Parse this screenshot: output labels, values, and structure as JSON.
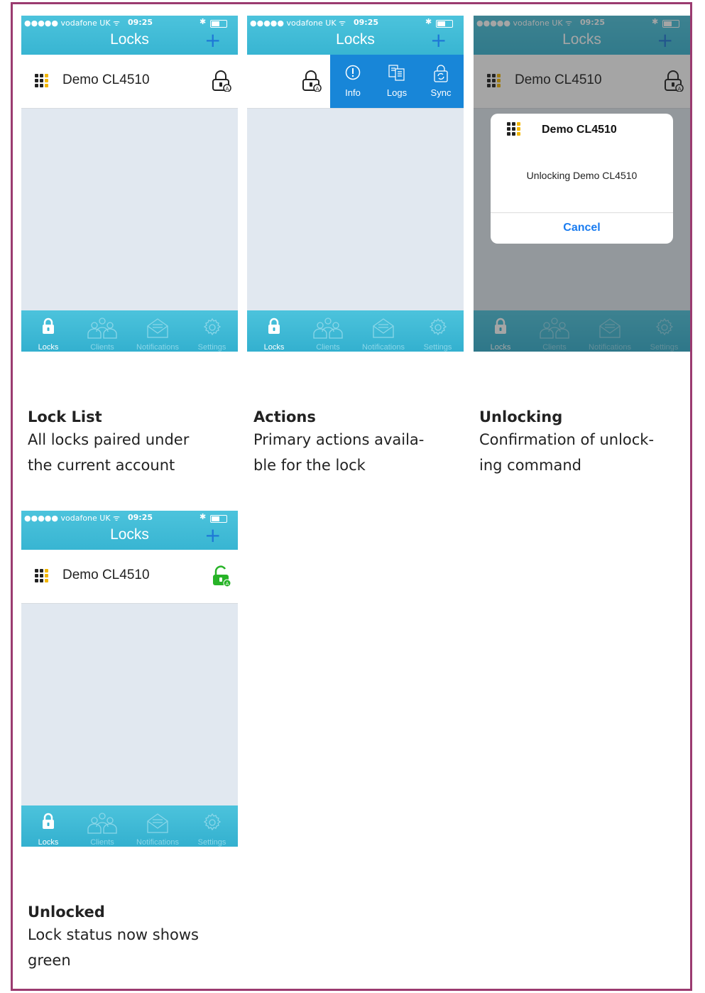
{
  "statusbar": {
    "carrier": "●●●●● vodafone UK ᯤ",
    "time": "09:25",
    "bluetooth": "✱"
  },
  "app": {
    "title": "Locks",
    "add_label": "+"
  },
  "lock": {
    "name": "Demo CL4510"
  },
  "tabs": [
    {
      "label": "Locks",
      "icon": "lock-icon"
    },
    {
      "label": "Clients",
      "icon": "people-icon"
    },
    {
      "label": "Notifications",
      "icon": "envelope-icon"
    },
    {
      "label": "Settings",
      "icon": "gear-icon"
    }
  ],
  "actions": [
    {
      "label": "Info",
      "icon": "info-icon"
    },
    {
      "label": "Logs",
      "icon": "logs-icon"
    },
    {
      "label": "Sync",
      "icon": "sync-icon"
    }
  ],
  "alert": {
    "title": "Demo CL4510",
    "message": "Unlocking Demo CL4510",
    "cancel_label": "Cancel"
  },
  "captions": [
    {
      "title": "Lock List",
      "text_line1": "All locks paired under",
      "text_line2": "the current account"
    },
    {
      "title": "Actions",
      "text_line1": "Primary actions availa-",
      "text_line2": "ble for the lock"
    },
    {
      "title": "Unlocking",
      "text_line1": "Confirmation of unlock-",
      "text_line2": "ing command"
    },
    {
      "title": "Unlocked",
      "text_line1": "Lock status now shows",
      "text_line2": "green"
    }
  ],
  "colors": {
    "border": "#9b3b70",
    "header": "#3fbad6",
    "accent": "#1e78d6",
    "actions_bg": "#1886d8",
    "unlocked": "#27b327"
  }
}
